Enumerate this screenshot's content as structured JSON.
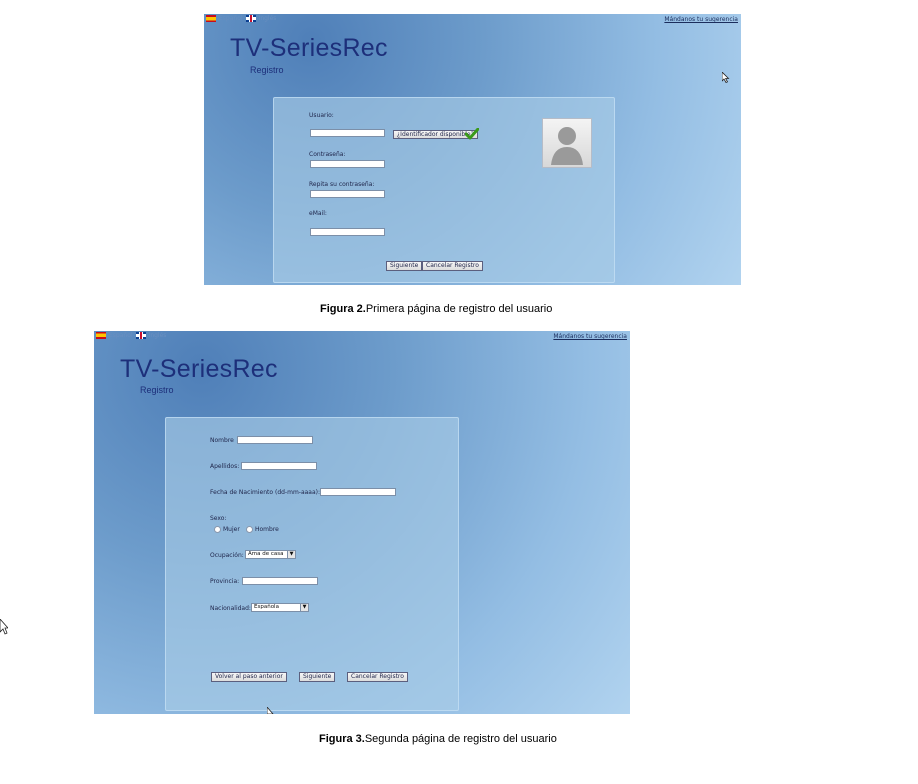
{
  "lang_spanish": "Español",
  "lang_english": "Inglés",
  "suggestion_link": "Mándanos tu sugerencia",
  "app_title": "TV-SeriesRec",
  "app_subtitle": "Registro",
  "figure2": {
    "user_label": "Usuario:",
    "check_id_button": "¿Identificador disponible?",
    "password_label": "Contraseña:",
    "repeat_password_label": "Repita su contraseña:",
    "email_label": "eMail:",
    "next_button": "Siguiente",
    "cancel_button": "Cancelar Registro",
    "caption_bold": "Figura 2.",
    "caption_text": "Primera página de registro del usuario"
  },
  "figure3": {
    "name_label": "Nombre",
    "surname_label": "Apellidos:",
    "birthdate_label": "Fecha de Nacimiento (dd-mm-aaaa):",
    "sex_label": "Sexo:",
    "female_option": "Mujer",
    "male_option": "Hombre",
    "occupation_label": "Ocupación:",
    "occupation_value": "Ama de casa",
    "province_label": "Provincia:",
    "nationality_label": "Nacionalidad:",
    "nationality_value": "Española",
    "back_button": "Volver al paso anterior",
    "next_button": "Siguiente",
    "cancel_button": "Cancelar Registro",
    "caption_bold": "Figura 3.",
    "caption_text": "Segunda página de registro del usuario"
  },
  "colors": {
    "title": "#1d2f7a",
    "checkmark": "#3a9a1a"
  },
  "icons": [
    "spain-flag-icon",
    "uk-flag-icon",
    "checkmark-icon",
    "user-avatar-icon",
    "mouse-cursor-icon",
    "dropdown-arrow-icon"
  ]
}
